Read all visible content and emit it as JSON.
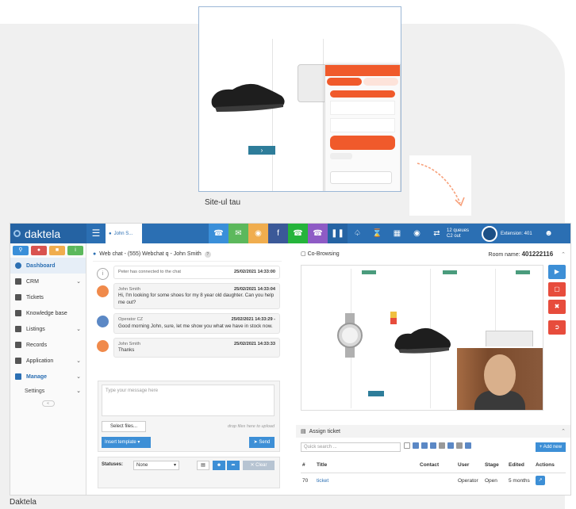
{
  "site": {
    "caption": "Site-ul tau"
  },
  "app": {
    "logo": "daktela",
    "chat_tab": "John S...",
    "queue_line1": "12 queues",
    "queue_line2": "C2 out",
    "extension": "Extension: 401",
    "sidebar": {
      "items": [
        {
          "label": "Dashboard",
          "icon": "dashboard-icon",
          "active": true
        },
        {
          "label": "CRM",
          "icon": "crm-icon",
          "chevron": true
        },
        {
          "label": "Tickets",
          "icon": "tickets-icon"
        },
        {
          "label": "Knowledge base",
          "icon": "knowledge-base-icon"
        },
        {
          "label": "Listings",
          "icon": "listings-icon",
          "chevron": true
        },
        {
          "label": "Records",
          "icon": "records-icon"
        },
        {
          "label": "Application",
          "icon": "application-icon",
          "chevron": true
        },
        {
          "label": "Manage",
          "icon": "manage-icon",
          "chevron": true,
          "active": true
        }
      ],
      "sub_items": [
        "Settings"
      ]
    },
    "chat": {
      "header": "Web chat - (555) Webchat q - John Smith",
      "messages": [
        {
          "type": "sys",
          "author": "Peter has connected to the chat",
          "time": "25/02/2021 14:33:00",
          "text": ""
        },
        {
          "type": "cust",
          "author": "John Smith",
          "time": "25/02/2021 14:33:04",
          "text": "Hi, I'm looking for some shoes for my 8 year old daughter. Can you help me out?"
        },
        {
          "type": "oper",
          "author": "Operator CZ",
          "time": "25/02/2021 14:33:29 -",
          "text": "Good morning John, sure, let me show you what we have in stock now."
        },
        {
          "type": "cust",
          "author": "John Smith",
          "time": "25/02/2021 14:33:33",
          "text": "Thanks"
        }
      ],
      "compose_placeholder": "Type your message here",
      "select_files": "Select files...",
      "drop_text": "drop files here to upload",
      "insert_template": "Insert template",
      "send": "Send",
      "statuses_label": "Statuses:",
      "status_value": "None",
      "clear": "Clear"
    },
    "cobrowse": {
      "title": "Co-Browsing",
      "room_label": "Room name:",
      "room_value": "401222116"
    },
    "ticket": {
      "title": "Assign ticket",
      "search_placeholder": "Quick search ...",
      "add_new": "Add new",
      "columns": [
        "#",
        "Title",
        "Contact",
        "User",
        "Stage",
        "Edited",
        "Actions"
      ],
      "rows": [
        {
          "id": "70",
          "title": "ticket",
          "contact": "",
          "user": "Operator",
          "stage": "Open",
          "edited": "5 months"
        }
      ]
    }
  },
  "footer": {
    "caption": "Daktela"
  },
  "colors": {
    "brand_blue": "#2b6fb3",
    "accent_orange": "#f05a2b"
  }
}
